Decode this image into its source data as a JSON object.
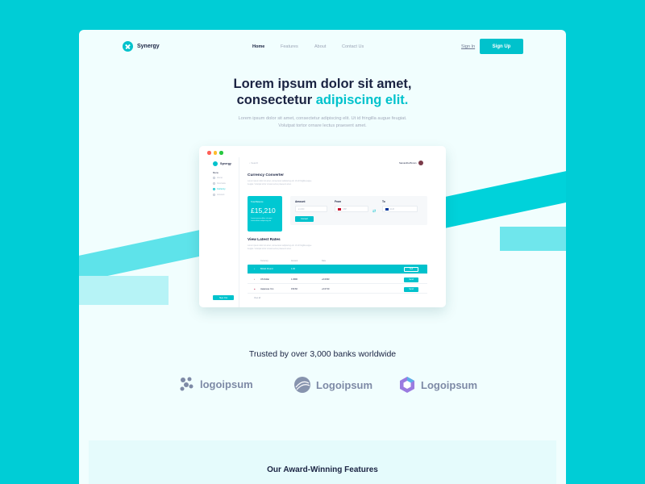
{
  "nav": {
    "brand": "Synergy",
    "links": [
      "Home",
      "Features",
      "About",
      "Contact Us"
    ],
    "signin": "Sign In",
    "signup": "Sign Up"
  },
  "hero": {
    "title_line1": "Lorem ipsum dolor sit amet,",
    "title_line2_plain": "consectetur ",
    "title_line2_accent": "adipiscing elit.",
    "subtitle": "Lorem ipsum dolor sit amet, consectetur adipiscing elit. Ut id fringilla augue feugiat. Volutpat tortor ornare lectus praesent amet."
  },
  "mockup": {
    "brand": "Synergy",
    "menu_heading": "Menu",
    "menu_items": [
      "Home",
      "Overview",
      "Currency",
      "Account"
    ],
    "search_placeholder": "Search",
    "user_name": "Samantha Brown",
    "sign_out": "Sign Out",
    "converter": {
      "heading": "Currency Converter",
      "description": "Lorem ipsum dolor sit amet, consectetur adipiscing elit. Ut id fringilla augue feugiat. Volutpat tortor ornare lectus praesent amet.",
      "balance_label": "Total Balance",
      "balance_value": "£15,210",
      "balance_desc": "Lorem ipsum dolor sit amet consectetur adipiscing elit",
      "amount_label": "Amount",
      "amount_placeholder": "£1,000",
      "from_label": "From",
      "from_value": "GBP",
      "to_label": "To",
      "to_value": "EUR",
      "convert_button": "Convert"
    },
    "rates": {
      "heading": "View Latest Rates",
      "description": "Lorem ipsum dolor sit amet, consectetur adipiscing elit. Ut id fringilla augue feugiat. Volutpat tortor ornare lectus praesent amet.",
      "columns": [
        "Currency",
        "Amount",
        "Rate"
      ],
      "rows": [
        {
          "currency": "British Pound",
          "amount": "1.00",
          "rate": "",
          "action": "Sell"
        },
        {
          "currency": "US Dollar",
          "amount": "1.3690",
          "rate": "+0.0033",
          "action": "Send"
        },
        {
          "currency": "Japanese Yen",
          "amount": "150.60",
          "rate": "+0.0710",
          "action": "Send"
        }
      ],
      "view_all": "View all"
    }
  },
  "trusted": {
    "title": "Trusted by over 3,000 banks worldwide",
    "logos": [
      "logoipsum",
      "Logoipsum",
      "Logoipsum"
    ]
  },
  "features": {
    "title": "Our Award-Winning Features"
  },
  "colors": {
    "brand": "#00C2CC",
    "background": "#00CDD6",
    "navy": "#1A2342"
  }
}
